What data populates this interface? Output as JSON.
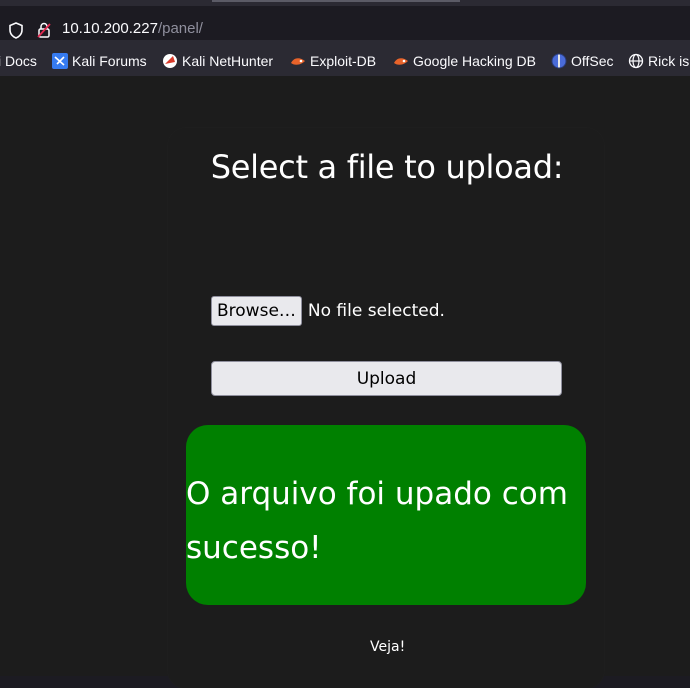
{
  "browser": {
    "url_host": "10.10.200.227",
    "url_path": "/panel/"
  },
  "bookmarks": [
    {
      "label": "i Docs",
      "icon": "kali-docs-icon"
    },
    {
      "label": "Kali Forums",
      "icon": "kali-forums-icon"
    },
    {
      "label": "Kali NetHunter",
      "icon": "kali-nethunter-icon"
    },
    {
      "label": "Exploit-DB",
      "icon": "exploit-db-icon"
    },
    {
      "label": "Google Hacking DB",
      "icon": "ghdb-icon"
    },
    {
      "label": "OffSec",
      "icon": "offsec-icon"
    },
    {
      "label": "Rick is",
      "icon": "globe-icon"
    }
  ],
  "page": {
    "heading": "Select a file to upload:",
    "browse_label": "Browse…",
    "file_status": "No file selected.",
    "upload_label": "Upload",
    "success_message": "O arquivo foi upado com sucesso!",
    "footer_text": "Veja!"
  },
  "colors": {
    "success_bg": "#008000",
    "page_bg": "#1c1c1c",
    "toolbar_bg": "#2b2a33"
  }
}
